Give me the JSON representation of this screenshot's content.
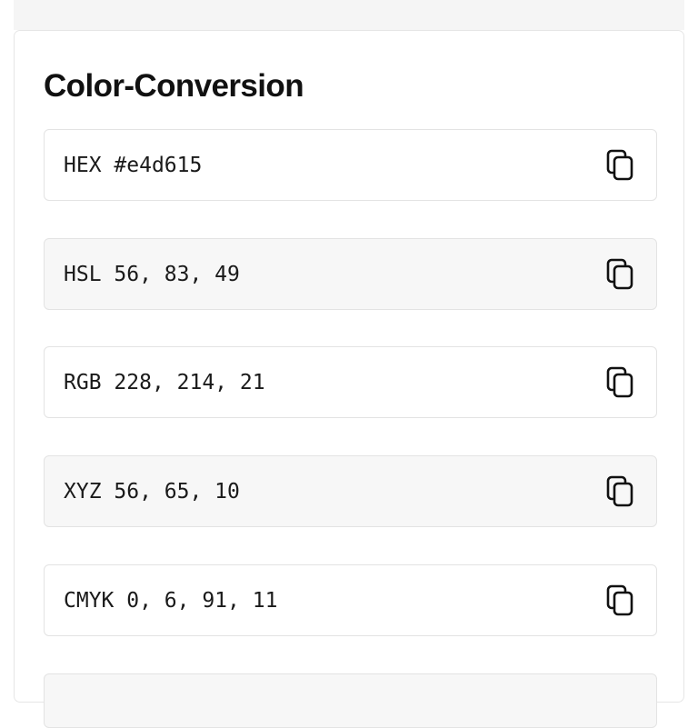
{
  "card": {
    "title": "Color-Conversion"
  },
  "conversions": [
    {
      "label": "HEX",
      "value": "#e4d615",
      "copy_icon": "copy-icon"
    },
    {
      "label": "HSL",
      "value": "56, 83, 49",
      "copy_icon": "copy-icon"
    },
    {
      "label": "RGB",
      "value": "228, 214, 21",
      "copy_icon": "copy-icon"
    },
    {
      "label": "XYZ",
      "value": "56, 65, 10",
      "copy_icon": "copy-icon"
    },
    {
      "label": "CMYK",
      "value": "0, 6, 91, 11",
      "copy_icon": "copy-icon"
    }
  ],
  "colors": {
    "row_border": "#e3e3e3",
    "row_shaded_bg": "#f7f7f7",
    "text": "#1a1a1a"
  }
}
